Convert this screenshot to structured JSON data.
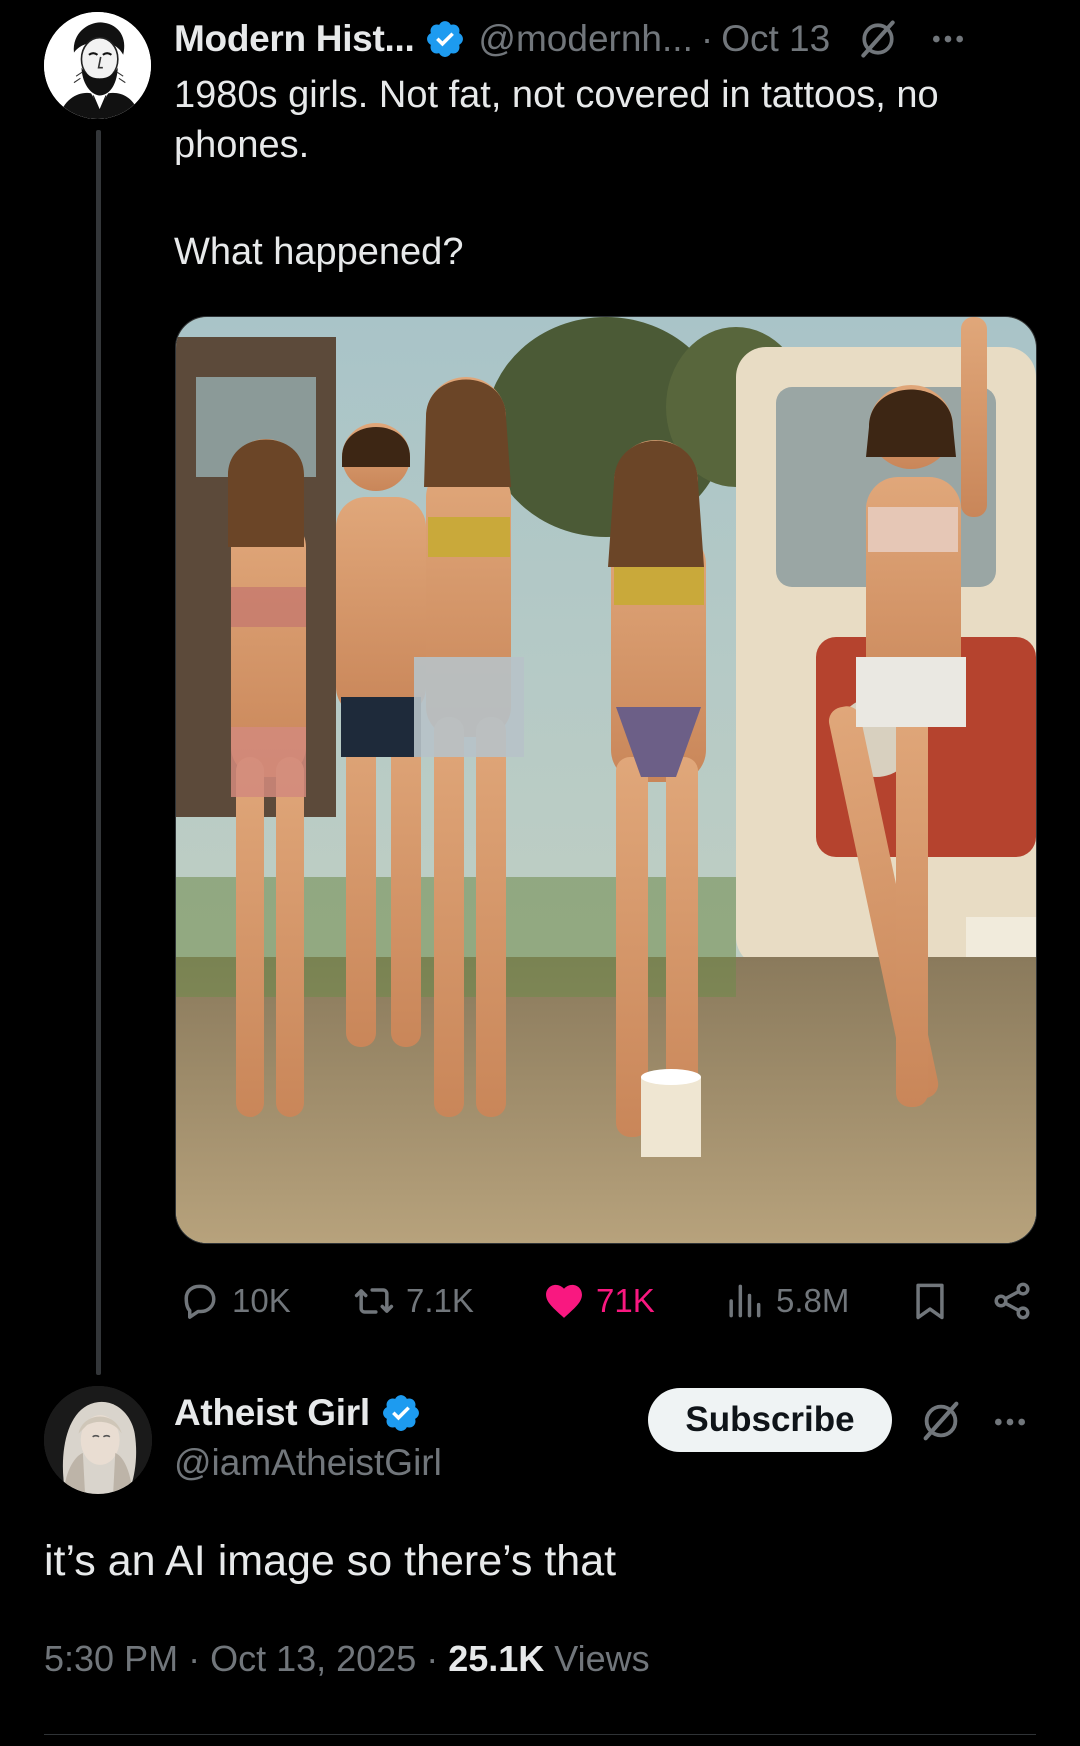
{
  "parent_tweet": {
    "display_name": "Modern Hist...",
    "handle": "@modernh...",
    "separator": "·",
    "date": "Oct 13",
    "text_line_1": "1980s girls. Not fat, not covered in tattoos, no phones.",
    "text_line_2": "What happened?",
    "avatar_icon": "lincoln-portrait",
    "media_description_icon": "photo",
    "actions": {
      "reply_count": "10K",
      "repost_count": "7.1K",
      "like_count": "71K",
      "views_count": "5.8M"
    },
    "liked": true
  },
  "reply_tweet": {
    "display_name": "Atheist Girl",
    "handle": "@iamAtheistGirl",
    "subscribe_label": "Subscribe",
    "text": "it’s an AI image so there’s that",
    "time": "5:30 PM",
    "separator_1": " · ",
    "date": "Oct 13, 2025",
    "separator_2": " · ",
    "views_count": "25.1K",
    "views_label": " Views"
  },
  "colors": {
    "background": "#000000",
    "text_primary": "#e7e9ea",
    "text_secondary": "#71767b",
    "verified_blue": "#1d9bf0",
    "like_pink": "#f91880",
    "subscribe_bg": "#eff3f4"
  },
  "icons": [
    "verified-badge-icon",
    "grok-icon",
    "more-icon",
    "reply-icon",
    "repost-icon",
    "heart-icon",
    "views-icon",
    "bookmark-icon",
    "share-icon"
  ]
}
